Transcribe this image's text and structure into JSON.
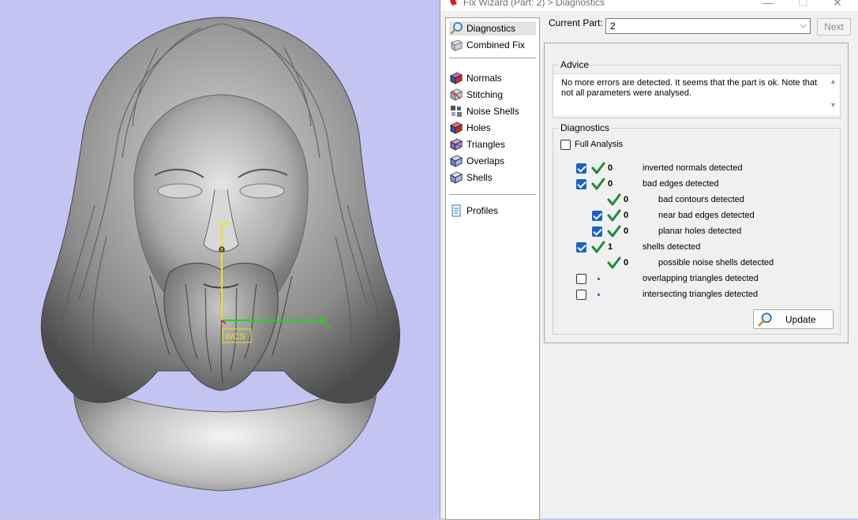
{
  "window": {
    "title": "Fix Wizard (Part: 2) > Diagnostics"
  },
  "nav": {
    "diagnostics": "Diagnostics",
    "combined_fix": "Combined Fix",
    "normals": "Normals",
    "stitching": "Stitching",
    "noise_shells": "Noise Shells",
    "holes": "Holes",
    "triangles": "Triangles",
    "overlaps": "Overlaps",
    "shells": "Shells",
    "profiles": "Profiles",
    "selected": "Diagnostics"
  },
  "current_part": {
    "label": "Current Part:",
    "value": "2",
    "next_label": "Next"
  },
  "advice": {
    "title": "Advice",
    "text": "No more errors are detected. It seems that the part is ok. Note that not all parameters were analysed."
  },
  "diagnostics": {
    "title": "Diagnostics",
    "full_analysis_label": "Full Analysis",
    "full_analysis_checked": false,
    "rows": [
      {
        "checked": true,
        "has_checkbox": true,
        "status": "ok",
        "count": "0",
        "label": "inverted normals detected"
      },
      {
        "checked": true,
        "has_checkbox": true,
        "status": "ok",
        "count": "0",
        "label": "bad edges detected"
      },
      {
        "checked": false,
        "has_checkbox": false,
        "status": "ok",
        "count": "0",
        "label": "bad contours detected"
      },
      {
        "checked": true,
        "has_checkbox": true,
        "status": "ok",
        "count": "0",
        "label": "near bad edges detected"
      },
      {
        "checked": true,
        "has_checkbox": true,
        "status": "ok",
        "count": "0",
        "label": "planar holes detected"
      },
      {
        "checked": true,
        "has_checkbox": true,
        "status": "ok",
        "count": "1",
        "label": "shells detected"
      },
      {
        "checked": false,
        "has_checkbox": false,
        "status": "ok",
        "count": "0",
        "label": "possible noise shells detected"
      },
      {
        "checked": false,
        "has_checkbox": true,
        "status": "pending",
        "count": "",
        "label": "overlapping triangles detected"
      },
      {
        "checked": false,
        "has_checkbox": true,
        "status": "pending",
        "count": "",
        "label": "intersecting triangles detected"
      }
    ],
    "update_label": "Update"
  },
  "viewport": {
    "background_color": "#c4c4f2",
    "axis_x_label": "x",
    "axis_y_label": "y",
    "wcs_label": "WCS",
    "axis_x_color": "#22d422",
    "axis_y_color": "#e6e61e"
  },
  "colors": {
    "ok_tick": "#1e8a3a",
    "checkbox": "#1764c5",
    "pending_dot": "#1f4fd6"
  }
}
